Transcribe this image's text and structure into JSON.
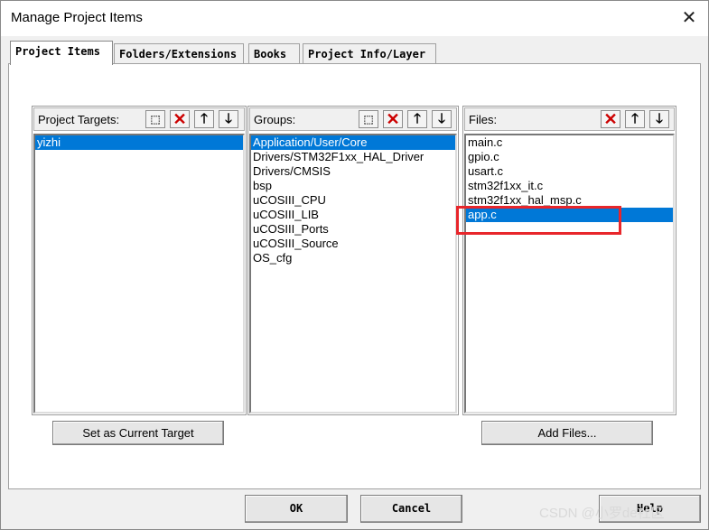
{
  "window": {
    "title": "Manage Project Items",
    "close_glyph": "✕"
  },
  "tabs": [
    {
      "label": "Project Items",
      "active": true
    },
    {
      "label": "Folders/Extensions",
      "active": false
    },
    {
      "label": "Books",
      "active": false
    },
    {
      "label": "Project Info/Layer",
      "active": false
    }
  ],
  "targets": {
    "label": "Project Targets:",
    "items": [
      "yizhi"
    ],
    "selected_index": 0,
    "set_current_button": "Set as Current Target"
  },
  "groups": {
    "label": "Groups:",
    "items": [
      "Application/User/Core",
      "Drivers/STM32F1xx_HAL_Driver",
      "Drivers/CMSIS",
      "bsp",
      "uCOSIII_CPU",
      "uCOSIII_LIB",
      "uCOSIII_Ports",
      "uCOSIII_Source",
      "OS_cfg"
    ],
    "selected_index": 0
  },
  "files": {
    "label": "Files:",
    "items": [
      "main.c",
      "gpio.c",
      "usart.c",
      "stm32f1xx_it.c",
      "stm32f1xx_hal_msp.c",
      "app.c"
    ],
    "selected_index": 5,
    "add_button": "Add Files..."
  },
  "toolbar_icons": {
    "new": "new-item-icon",
    "delete": "delete-icon",
    "up": "move-up-icon",
    "down": "move-down-icon"
  },
  "footer": {
    "ok": "OK",
    "cancel": "Cancel",
    "help": "Help"
  },
  "watermark": "CSDN @小罗de社区",
  "colors": {
    "selection": "#0078d7",
    "highlight_box": "#e8262b"
  }
}
